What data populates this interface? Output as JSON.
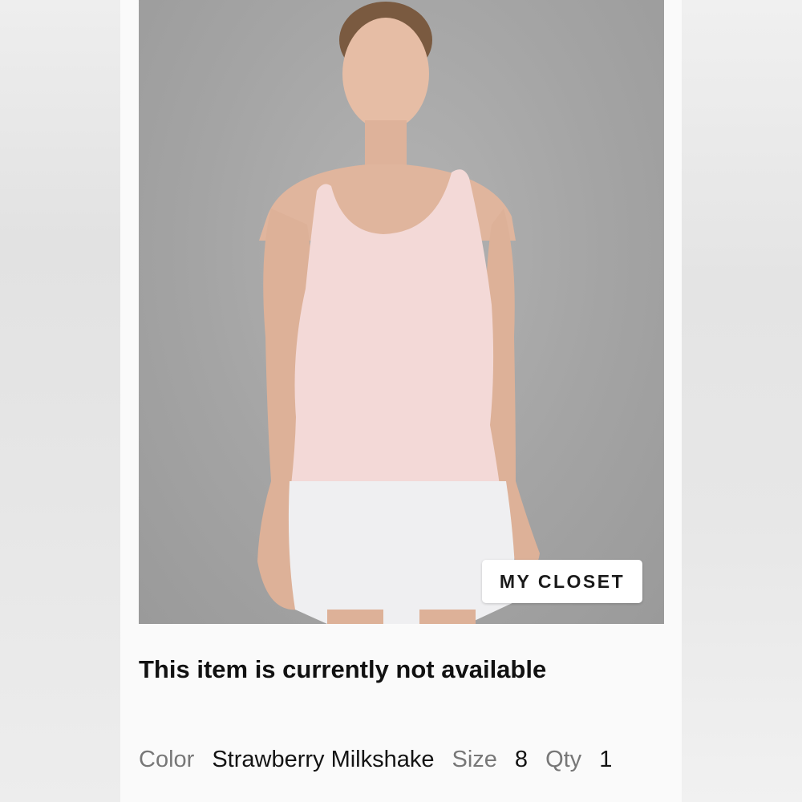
{
  "product": {
    "image_alt": "Model wearing light pink ribbed tank top and white shorts",
    "closet_button_label": "MY CLOSET",
    "availability_text": "This item is currently not available"
  },
  "attributes": {
    "color_label": "Color",
    "color_value": "Strawberry Milkshake",
    "size_label": "Size",
    "size_value": "8",
    "qty_label": "Qty",
    "qty_value": "1"
  },
  "colors": {
    "image_background": "#a8a8a8",
    "tank_top": "#f3d9d7",
    "shorts": "#efeff1",
    "skin": "#e2b79f",
    "button_bg": "#ffffff",
    "text_primary": "#111111",
    "text_muted": "#777777"
  }
}
